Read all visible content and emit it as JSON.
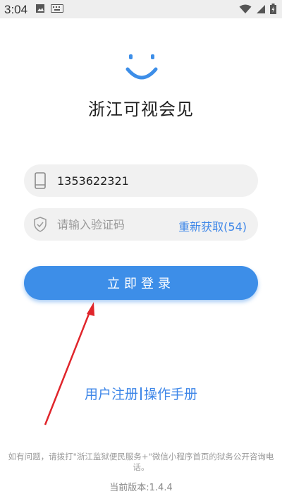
{
  "status_bar": {
    "time": "3:04",
    "left_icons": [
      "image-icon",
      "keyboard-icon"
    ],
    "right_icons": [
      "wifi-icon",
      "signal-icon",
      "battery-icon"
    ]
  },
  "app": {
    "title": "浙江可视会见",
    "logo_icon": "smile-logo-icon",
    "brand_color": "#3d8ee8"
  },
  "form": {
    "phone": {
      "icon": "phone-icon",
      "value": "1353622321"
    },
    "code": {
      "icon": "shield-icon",
      "placeholder": "请输入验证码",
      "resend_label": "重新获取(54)"
    },
    "login_label": "立即登录"
  },
  "links": {
    "register": "用户注册",
    "manual": "操作手册"
  },
  "footer": {
    "note": "如有问题，请拨打\"浙江监狱便民服务+\"微信小程序首页的狱务公开咨询电话。",
    "version": "当前版本:1.4.4"
  },
  "annotation": {
    "arrow_color": "#e0252b"
  }
}
